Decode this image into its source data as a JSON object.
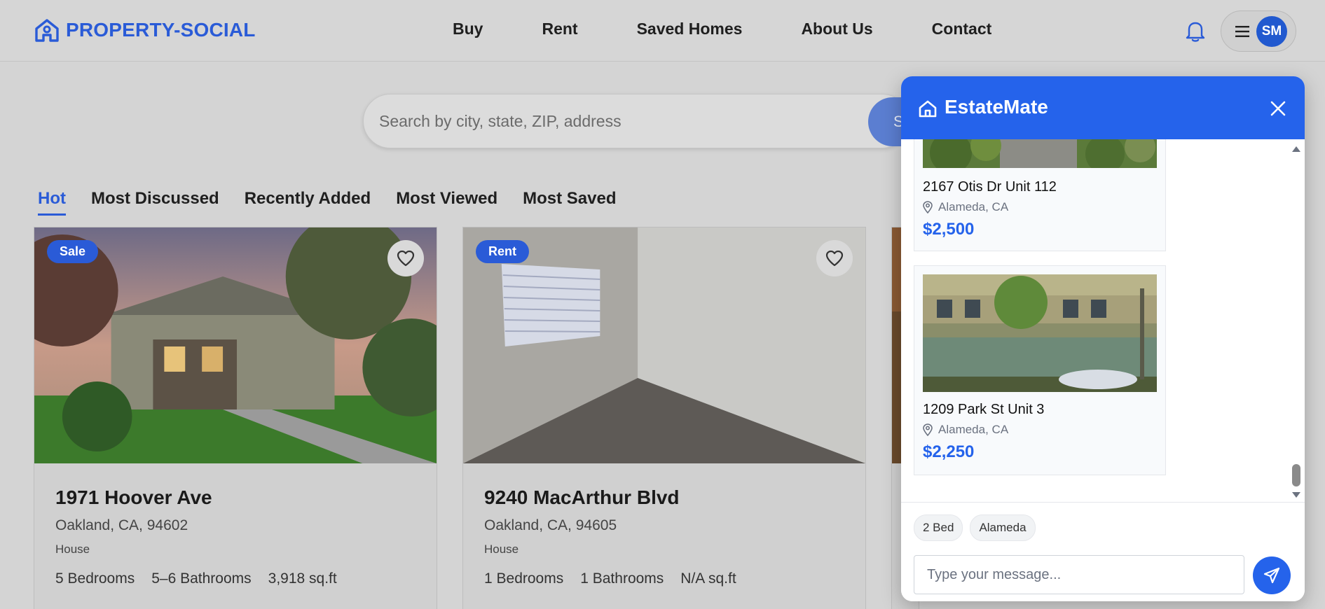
{
  "header": {
    "logo_text": "PROPERTY-SOCIAL",
    "nav": [
      "Buy",
      "Rent",
      "Saved Homes",
      "About Us",
      "Contact"
    ],
    "avatar_initials": "SM",
    "icons": [
      "house-logo-icon",
      "bell-icon",
      "menu-icon"
    ]
  },
  "search": {
    "placeholder": "Search by city, state, ZIP, address",
    "button_label": "S"
  },
  "tabs": [
    "Hot",
    "Most Discussed",
    "Recently Added",
    "Most Viewed",
    "Most Saved"
  ],
  "active_tab": "Hot",
  "cards": [
    {
      "badge": "Sale",
      "title": "1971 Hoover Ave",
      "address": "Oakland, CA, 94602",
      "type": "House",
      "stats": [
        "5 Bedrooms",
        "5–6 Bathrooms",
        "3,918 sq.ft"
      ]
    },
    {
      "badge": "Rent",
      "title": "9240 MacArthur Blvd",
      "address": "Oakland, CA, 94605",
      "type": "House",
      "stats": [
        "1 Bedrooms",
        "1 Bathrooms",
        "N/A sq.ft"
      ]
    }
  ],
  "chat": {
    "title": "EstateMate",
    "listings": [
      {
        "title": "2167 Otis Dr Unit 112",
        "location": "Alameda, CA",
        "price": "$2,500"
      },
      {
        "title": "1209 Park St Unit 3",
        "location": "Alameda, CA",
        "price": "$2,250"
      }
    ],
    "chips": [
      "2 Bed",
      "Alameda"
    ],
    "input_placeholder": "Type your message...",
    "colors": {
      "accent": "#2563eb"
    }
  },
  "colors": {
    "brand": "#2a5bd7",
    "badge": "#2a5bd7"
  }
}
